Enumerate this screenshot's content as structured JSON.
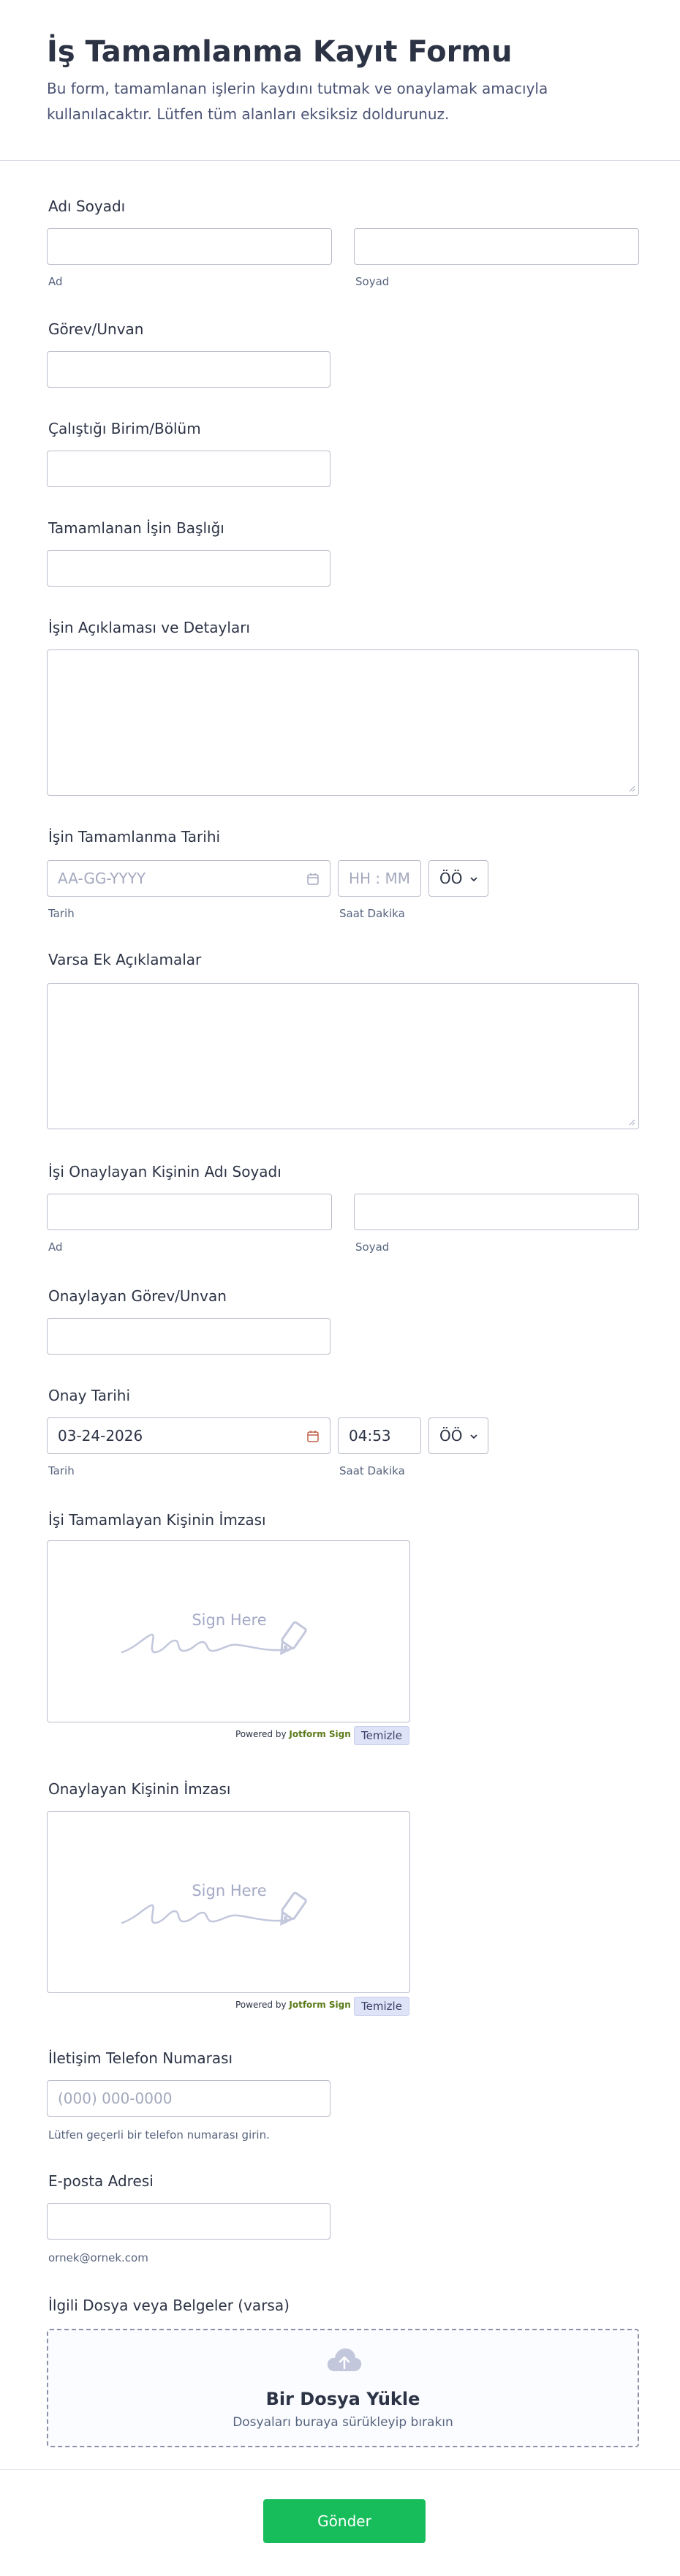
{
  "form": {
    "title": "İş Tamamlanma Kayıt Formu",
    "description": "Bu form, tamamlanan işlerin kaydını tutmak ve onaylamak amacıyla kullanılacaktır. Lütfen tüm alanları eksiksiz doldurunuz."
  },
  "full_name": {
    "label": "Adı Soyadı",
    "first_value": "",
    "last_value": "",
    "first_sub": "Ad",
    "last_sub": "Soyad"
  },
  "position": {
    "label": "Görev/Unvan",
    "value": ""
  },
  "department": {
    "label": "Çalıştığı Birim/Bölüm",
    "value": ""
  },
  "job_title": {
    "label": "Tamamlanan İşin Başlığı",
    "value": ""
  },
  "job_details": {
    "label": "İşin Açıklaması ve Detayları",
    "value": ""
  },
  "completion_date": {
    "label": "İşin Tamamlanma Tarihi",
    "date_placeholder": "AA-GG-YYYY",
    "time_placeholder": "HH : MM",
    "ampm": "ÖÖ",
    "date_sub": "Tarih",
    "time_sub": "Saat Dakika"
  },
  "extra_notes": {
    "label": "Varsa Ek Açıklamalar",
    "value": ""
  },
  "approver_name": {
    "label": "İşi Onaylayan Kişinin Adı Soyadı",
    "first_value": "",
    "last_value": "",
    "first_sub": "Ad",
    "last_sub": "Soyad"
  },
  "approver_position": {
    "label": "Onaylayan Görev/Unvan",
    "value": ""
  },
  "approval_date": {
    "label": "Onay Tarihi",
    "date_value": "03-24-2026",
    "time_value": "04:53",
    "ampm": "ÖÖ",
    "date_sub": "Tarih",
    "time_sub": "Saat Dakika"
  },
  "worker_signature": {
    "label": "İşi Tamamlayan Kişinin İmzası",
    "sign_text": "Sign Here",
    "powered_prefix": "Powered by",
    "powered_brand": "Jotform Sign",
    "clear_label": "Temizle"
  },
  "approver_signature": {
    "label": "Onaylayan Kişinin İmzası",
    "sign_text": "Sign Here",
    "powered_prefix": "Powered by",
    "powered_brand": "Jotform Sign",
    "clear_label": "Temizle"
  },
  "phone": {
    "label": "İletişim Telefon Numarası",
    "placeholder": "(000) 000-0000",
    "help": "Lütfen geçerli bir telefon numarası girin."
  },
  "email": {
    "label": "E-posta Adresi",
    "value": "",
    "help": "ornek@ornek.com"
  },
  "files": {
    "label": "İlgili Dosya veya Belgeler (varsa)",
    "title": "Bir Dosya Yükle",
    "subtitle": "Dosyaları buraya sürükleyip bırakın"
  },
  "submit": {
    "label": "Gönder"
  },
  "colors": {
    "submit": "#18bd5b",
    "powered_brand": "#5b7a18",
    "clear_button": "#dfe3f7",
    "text": "#2c3345"
  }
}
